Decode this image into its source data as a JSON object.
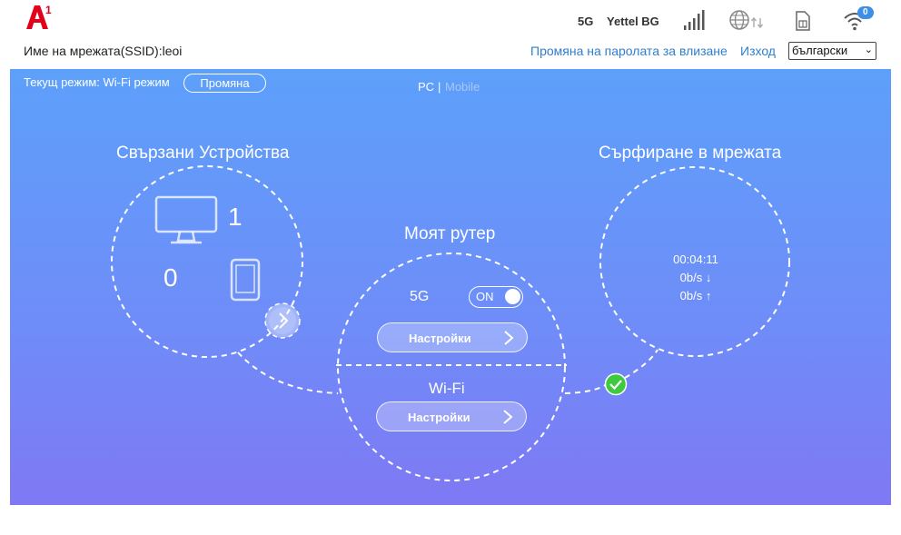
{
  "header": {
    "logo_text": "A1",
    "ssid_label": "Име на мрежата(SSID):leoi",
    "network_type": "5G",
    "operator": "Yettel BG",
    "wifi_client_count": "0",
    "change_password_link": "Промяна на паролата за влизане",
    "logout_link": "Изход",
    "language_selected": "български",
    "icons": [
      "signal-bars-icon",
      "globe-data-icon",
      "sim-card-icon",
      "wifi-icon"
    ]
  },
  "mode_bar": {
    "current_mode": "Текущ режим: Wi-Fi режим",
    "change_button": "Промяна",
    "view_pc": "PC",
    "view_separator": "|",
    "view_mobile": "Mobile"
  },
  "devices": {
    "title": "Свързани Устройства",
    "pc_count": "1",
    "mobile_count": "0"
  },
  "router": {
    "title": "Моят рутер",
    "band_label": "5G",
    "toggle_state": "ON",
    "settings_5g": "Настройки",
    "wifi_label": "Wi-Fi",
    "settings_wifi": "Настройки"
  },
  "internet": {
    "title": "Сърфиране в мрежата",
    "duration": "00:04:11",
    "download": "0b/s ↓",
    "upload": "0b/s ↑",
    "status": "connected"
  },
  "colors": {
    "panel_top": "#5da0fa",
    "panel_bottom": "#7f78f4",
    "brand_red": "#e3001b",
    "link_blue": "#2f7fd0",
    "connected_green": "#3ec93e"
  }
}
